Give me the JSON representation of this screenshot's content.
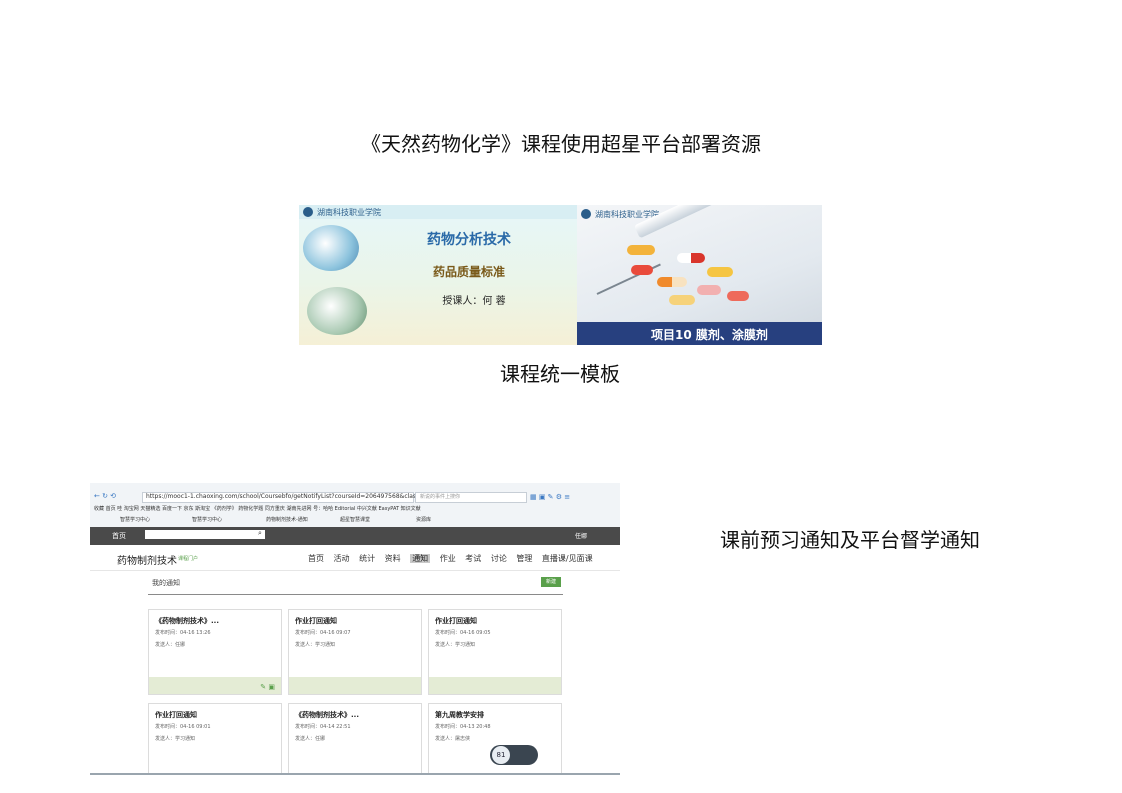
{
  "title": "《天然药物化学》课程使用超星平台部署资源",
  "template_caption": "课程统一模板",
  "notice_caption": "课前预习通知及平台督学通知",
  "slide1": {
    "logo": "湖南科技职业学院",
    "title": "药物分析技术",
    "subtitle": "药品质量标准",
    "teacher": "授课人：何 蓉"
  },
  "slide2": {
    "logo": "湖南科技职业学院",
    "bar_text": "项目10 膜剂、涂膜剂"
  },
  "screenshot": {
    "url": "https://mooc1-1.chaoxing.com/school/Coursebfo/getNotifyList?courseId=206497568&class",
    "search_placeholder": "新说的事件上搜你",
    "bookmarks": "收藏  首页  哇  淘宝网  天猫精选  百度一下  京东  斯淘宝  《药剂学》  药物化学题  同方重庆  湖南先进网  号：哈哈  Editorial  中兴文献  EasyPAT  知识文献",
    "tabs": [
      "智慧学习中心",
      "智慧学习中心",
      "药物制剂技术-通知",
      "超星智慧课堂",
      "资源库"
    ],
    "home_link": "首页",
    "user_name": "任娜",
    "course_name": "药物制剂技术",
    "course_sub": "课程门户",
    "nav": [
      "首页",
      "活动",
      "统计",
      "资料",
      "通知",
      "作业",
      "考试",
      "讨论",
      "管理",
      "直播课/见面课"
    ],
    "active_nav": "通知",
    "section_title": "我的通知",
    "new_button": "新建",
    "cards": [
      {
        "title": "《药物制剂技术》...",
        "time": "发布时间：04-16 13:26",
        "from": "发送人：任娜"
      },
      {
        "title": "作业打回通知",
        "time": "发布时间：04-16 09:07",
        "from": "发送人：学习通知"
      },
      {
        "title": "作业打回通知",
        "time": "发布时间：04-16 09:05",
        "from": "发送人：学习通知"
      },
      {
        "title": "作业打回通知",
        "time": "发布时间：04-16 09:01",
        "from": "发送人：学习通知"
      },
      {
        "title": "《药物制剂技术》...",
        "time": "发布时间：04-14 22:51",
        "from": "发送人：任娜"
      },
      {
        "title": "第九周教学安排",
        "time": "发布时间：04-13 20:48",
        "from": "发送人：屠志侠"
      }
    ],
    "badge_value": "81"
  }
}
